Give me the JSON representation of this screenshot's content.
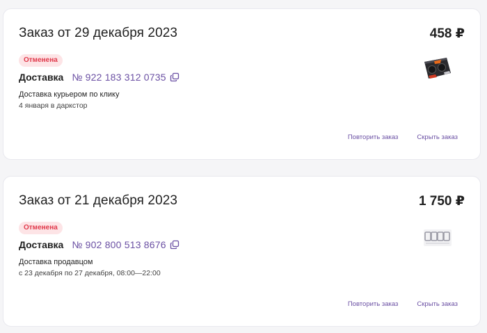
{
  "orders": [
    {
      "title": "Заказ от 29 декабря 2023",
      "price": "458 ₽",
      "status": "Отменена",
      "delivery_label": "Доставка",
      "order_number": "№ 922 183 312 0735",
      "delivery_method": "Доставка курьером по клику",
      "delivery_date": "4 января в даркстор",
      "thumbnail_icon": "gpu-product-icon",
      "repeat_label": "Повторить заказ",
      "hide_label": "Скрыть заказ"
    },
    {
      "title": "Заказ от 21 декабря 2023",
      "price": "1 750 ₽",
      "status": "Отменена",
      "delivery_label": "Доставка",
      "order_number": "№ 902 800 513 8676",
      "delivery_method": "Доставка продавцом",
      "delivery_date": "с 23 декабря по 27 декабря, 08:00—22:00",
      "thumbnail_icon": "sticker-product-icon",
      "repeat_label": "Повторить заказ",
      "hide_label": "Скрыть заказ"
    }
  ],
  "colors": {
    "accent": "#6a4fa3",
    "status_text": "#e0384a",
    "status_bg": "#fde4e6"
  }
}
